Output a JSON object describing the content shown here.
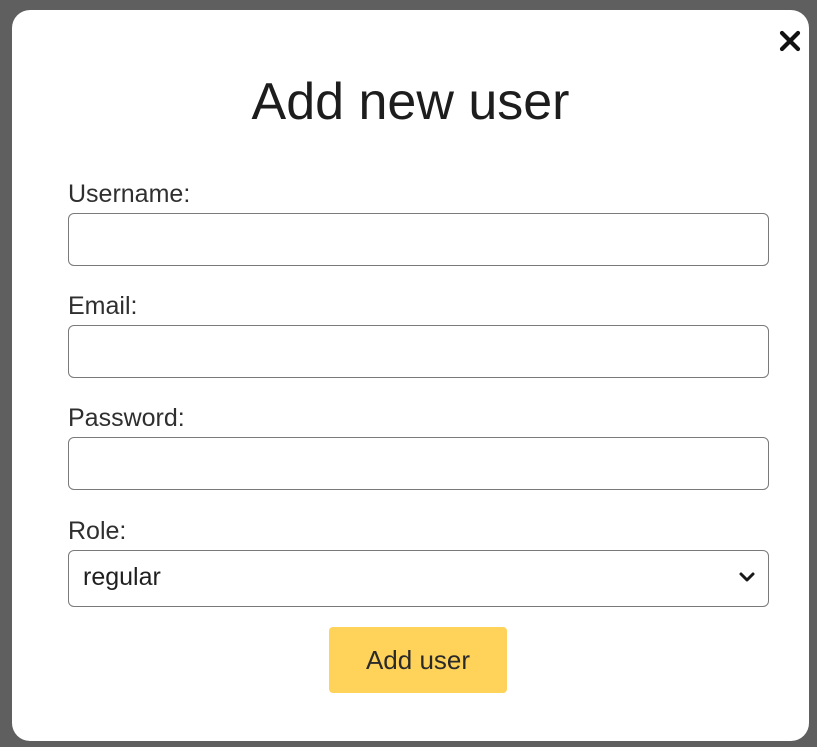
{
  "dialog": {
    "title": "Add new user",
    "close_icon": "close-icon"
  },
  "form": {
    "username": {
      "label": "Username:",
      "value": "",
      "placeholder": ""
    },
    "email": {
      "label": "Email:",
      "value": "",
      "placeholder": ""
    },
    "password": {
      "label": "Password:",
      "value": "",
      "placeholder": ""
    },
    "role": {
      "label": "Role:",
      "selected": "regular",
      "icon": "chevron-down-icon"
    },
    "submit_label": "Add user"
  },
  "colors": {
    "backdrop": "#5f5f5f",
    "dialog_background": "#ffffff",
    "button_background": "#ffd35a",
    "input_border": "#7a7a7a"
  }
}
